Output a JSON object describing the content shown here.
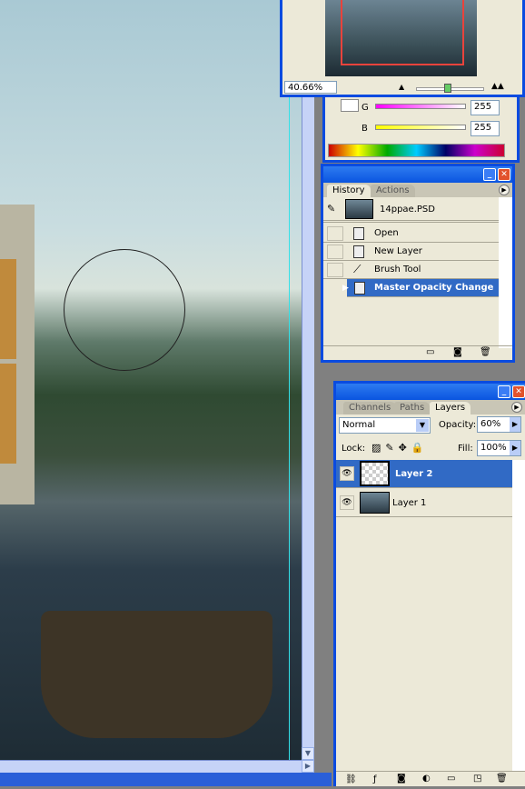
{
  "navigator": {
    "zoom": "40.66%"
  },
  "color": {
    "channels": [
      {
        "label": "G",
        "value": "255"
      },
      {
        "label": "B",
        "value": "255"
      }
    ]
  },
  "history": {
    "tabs": [
      "History",
      "Actions"
    ],
    "snapshot": "14ppae.PSD",
    "items": [
      {
        "label": "Open",
        "icon": "document-icon"
      },
      {
        "label": "New Layer",
        "icon": "document-icon"
      },
      {
        "label": "Brush Tool",
        "icon": "brush-icon"
      },
      {
        "label": "Master Opacity Change",
        "icon": "document-icon",
        "selected": true
      }
    ]
  },
  "layers": {
    "tabs": [
      "Channels",
      "Paths",
      "Layers"
    ],
    "blend_mode": "Normal",
    "opacity_label": "Opacity:",
    "opacity": "60%",
    "lock_label": "Lock:",
    "fill_label": "Fill:",
    "fill": "100%",
    "items": [
      {
        "name": "Layer 2",
        "selected": true,
        "visible": true
      },
      {
        "name": "Layer 1",
        "selected": false,
        "visible": true
      }
    ]
  },
  "colors": {
    "accent": "#0a4be0",
    "selection": "#316ac5"
  }
}
